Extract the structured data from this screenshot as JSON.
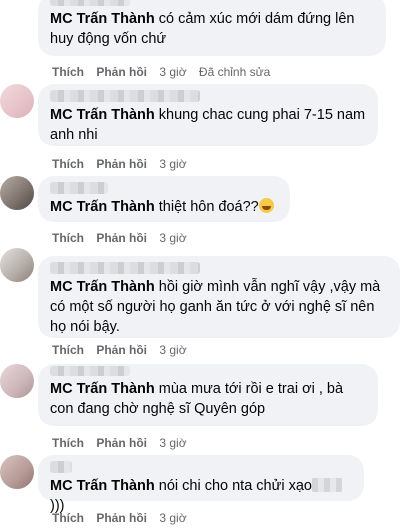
{
  "actions": {
    "like": "Thích",
    "reply": "Phản hồi"
  },
  "comments": [
    {
      "tag": "MC Trấn Thành",
      "text": " có cảm xúc mới dám đứng lên huy động vốn chứ",
      "time": "3 giờ",
      "edited": "Đã chỉnh sửa"
    },
    {
      "tag": "MC Trấn Thành",
      "text": " khung chac cung phai 7-15 nam anh nhi",
      "time": "3 giờ"
    },
    {
      "tag": "MC Trấn Thành",
      "text": " thiệt hôn đoá??",
      "time": "3 giờ",
      "emoji": "grinning-sweat-emoji"
    },
    {
      "tag": "MC Trấn Thành",
      "text": " hồi giờ mình vẫn nghĩ vậy ,vậy mà có một số người họ ganh ăn tức ở với nghệ sĩ nên họ nói bậy.",
      "time": "3 giờ"
    },
    {
      "tag": "MC Trấn Thành",
      "text": " mùa mưa tới rồi e trai ơi , bà con đang chờ nghệ sĩ Quyên góp",
      "time": "3 giờ"
    },
    {
      "tag": "MC Trấn Thành",
      "text": " nói chi cho nta chửi xạo",
      "text_tail": " )))",
      "time": "3 giờ"
    }
  ]
}
